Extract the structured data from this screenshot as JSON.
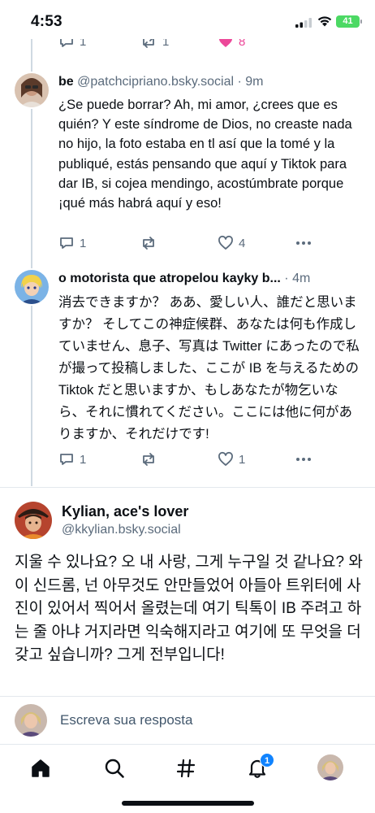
{
  "status_bar": {
    "time": "4:53",
    "battery": "41"
  },
  "top_actions": {
    "reply_count": "1",
    "repost_count": "1",
    "like_count": "8",
    "like_color": "#ec4899"
  },
  "posts": [
    {
      "display_name": "be",
      "handle": "@patchcipriano.bsky.social",
      "time": "9m",
      "text": "¿Se puede borrar? Ah, mi amor, ¿crees que es quién? Y este síndrome de Dios, no creaste nada no hijo, la foto estaba en tl así que la tomé y la publiqué, estás pensando que aquí y Tiktok para dar IB, si cojea mendingo, acostúmbrate porque ¡qué más habrá aquí y eso!",
      "reply_count": "1",
      "repost_count": "",
      "like_count": "4"
    },
    {
      "display_name": "o motorista que atropelou kayky b...",
      "handle": "",
      "time": "4m",
      "text": "消去できますか？ ああ、愛しい人、誰だと思いますか？ そしてこの神症候群、あなたは何も作成していません、息子、写真は Twitter にあったので私が撮って投稿しました、ここが IB を与えるためのTiktok だと思いますか、もしあなたが物乞いなら、それに慣れてください。ここには他に何がありますか、それだけです!",
      "reply_count": "1",
      "repost_count": "",
      "like_count": "1"
    }
  ],
  "focused_post": {
    "display_name": "Kylian, ace's lover",
    "handle": "@kkylian.bsky.social",
    "text": "지울 수 있나요? 오 내 사랑, 그게 누구일 것 같나요? 와 이 신드롬, 넌 아무것도 안만들었어 아들아 트위터에 사진이 있어서 찍어서 올렸는데 여기 틱톡이 IB 주려고 하는 줄 아냐 거지라면 익숙해지라고 여기에 또 무엇을 더 갖고 싶습니까? 그게 전부입니다!"
  },
  "reply_bar": {
    "placeholder": "Escreva sua resposta"
  },
  "tab_bar": {
    "notifications_badge": "1",
    "active_tab": "home",
    "items": [
      "home-icon",
      "search-icon",
      "feeds-hash-icon",
      "notifications-bell-icon",
      "profile-avatar"
    ]
  },
  "colors": {
    "text": "#0b0f14",
    "muted": "#5b6b7c",
    "accent": "#1083fe",
    "like": "#ec4899"
  }
}
